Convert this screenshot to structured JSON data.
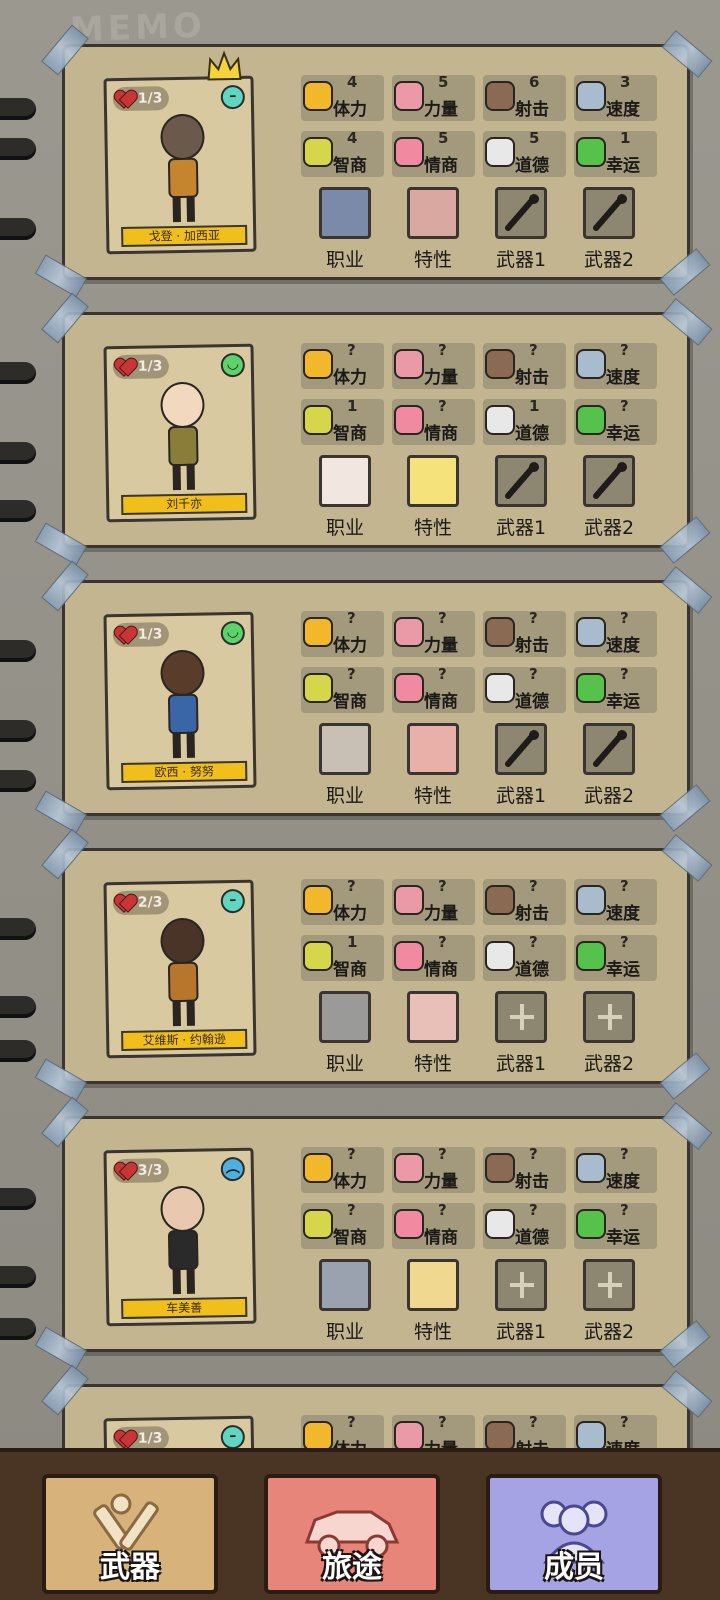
{
  "memo_header": "MEMO",
  "colors": {
    "hp_heart": "#c93434",
    "mood_neutral": "#5fd6c0",
    "mood_happy": "#5cd36a",
    "mood_sad": "#4fb0e0",
    "name_plate": "#f1bf1c",
    "nav_weapons": "#d7b27a",
    "nav_journey": "#e7857a",
    "nav_members": "#a5a3e3"
  },
  "stat_labels": {
    "stamina": "体力",
    "strength": "力量",
    "shooting": "射击",
    "speed": "速度",
    "intellect": "智商",
    "emotion": "情商",
    "morality": "道德",
    "luck": "幸运"
  },
  "slot_labels": {
    "job": "职业",
    "trait": "特性",
    "weapon1": "武器1",
    "weapon2": "武器2"
  },
  "members": [
    {
      "hp": "1/3",
      "mood": "neutral",
      "name": "戈登 · 加西亚",
      "leader": true,
      "stats": {
        "stamina": "4",
        "strength": "5",
        "shooting": "6",
        "speed": "3",
        "intellect": "4",
        "emotion": "5",
        "morality": "5",
        "luck": "1"
      },
      "weapon1": "filled",
      "weapon2": "filled"
    },
    {
      "hp": "1/3",
      "mood": "happy",
      "name": "刘千亦",
      "leader": false,
      "stats": {
        "stamina": "?",
        "strength": "?",
        "shooting": "?",
        "speed": "?",
        "intellect": "1",
        "emotion": "?",
        "morality": "1",
        "luck": "?"
      },
      "weapon1": "filled",
      "weapon2": "filled"
    },
    {
      "hp": "1/3",
      "mood": "happy",
      "name": "欧西 · 努努",
      "leader": false,
      "stats": {
        "stamina": "?",
        "strength": "?",
        "shooting": "?",
        "speed": "?",
        "intellect": "?",
        "emotion": "?",
        "morality": "?",
        "luck": "?"
      },
      "weapon1": "filled",
      "weapon2": "filled"
    },
    {
      "hp": "2/3",
      "mood": "neutral",
      "name": "艾维斯 · 约翰逊",
      "leader": false,
      "stats": {
        "stamina": "?",
        "strength": "?",
        "shooting": "?",
        "speed": "?",
        "intellect": "1",
        "emotion": "?",
        "morality": "?",
        "luck": "?"
      },
      "weapon1": "empty",
      "weapon2": "empty"
    },
    {
      "hp": "3/3",
      "mood": "sad",
      "name": "车美善",
      "leader": false,
      "stats": {
        "stamina": "?",
        "strength": "?",
        "shooting": "?",
        "speed": "?",
        "intellect": "?",
        "emotion": "?",
        "morality": "?",
        "luck": "?"
      },
      "weapon1": "empty",
      "weapon2": "empty"
    },
    {
      "hp": "1/3",
      "mood": "neutral",
      "name": "",
      "leader": false,
      "stats": {
        "stamina": "?",
        "strength": "?",
        "shooting": "?",
        "speed": "?"
      },
      "weapon1": "empty",
      "weapon2": "empty"
    }
  ],
  "nav": {
    "weapons": "武器",
    "journey": "旅途",
    "members": "成员"
  }
}
